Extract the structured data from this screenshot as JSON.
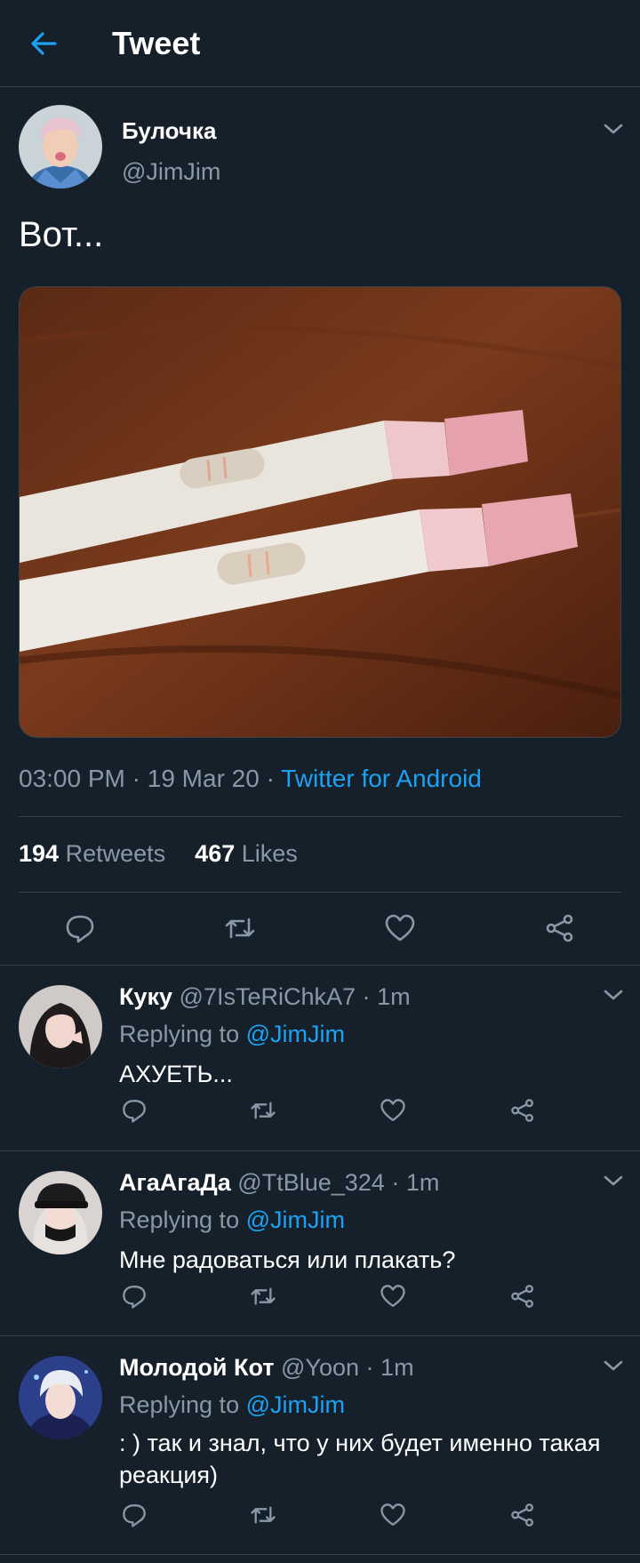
{
  "header": {
    "title": "Tweet"
  },
  "tweet": {
    "author_name": "Булочка",
    "author_handle": "@JimJim",
    "text": "Вот...",
    "time": "03:00 PM",
    "sep1": " · ",
    "date": "19 Mar 20",
    "sep2": " · ",
    "source": "Twitter for Android",
    "retweets_count": "194",
    "retweets_label": "Retweets",
    "likes_count": "467",
    "likes_label": "Likes"
  },
  "replies": [
    {
      "name": "Куку",
      "handle": "@7IsTeRiChkA7",
      "time": "1m",
      "replying_prefix": "Replying to",
      "replying_to": "@JimJim",
      "text": "АХУЕТЬ..."
    },
    {
      "name": "АгаАгаДа",
      "handle": "@TtBlue_324",
      "time": "1m",
      "replying_prefix": "Replying to",
      "replying_to": "@JimJim",
      "text": "Мне радоваться или плакать?"
    },
    {
      "name": "Молодой Кот",
      "handle": "@Yoon",
      "time": "1m",
      "replying_prefix": "Replying to",
      "replying_to": "@JimJim",
      "text": ": ) так и знал, что у них будет именно такая реакция)"
    }
  ],
  "colors": {
    "background": "#15202b",
    "accent": "#1da1f2",
    "secondary_text": "#8899a6",
    "divider": "#38444d"
  }
}
